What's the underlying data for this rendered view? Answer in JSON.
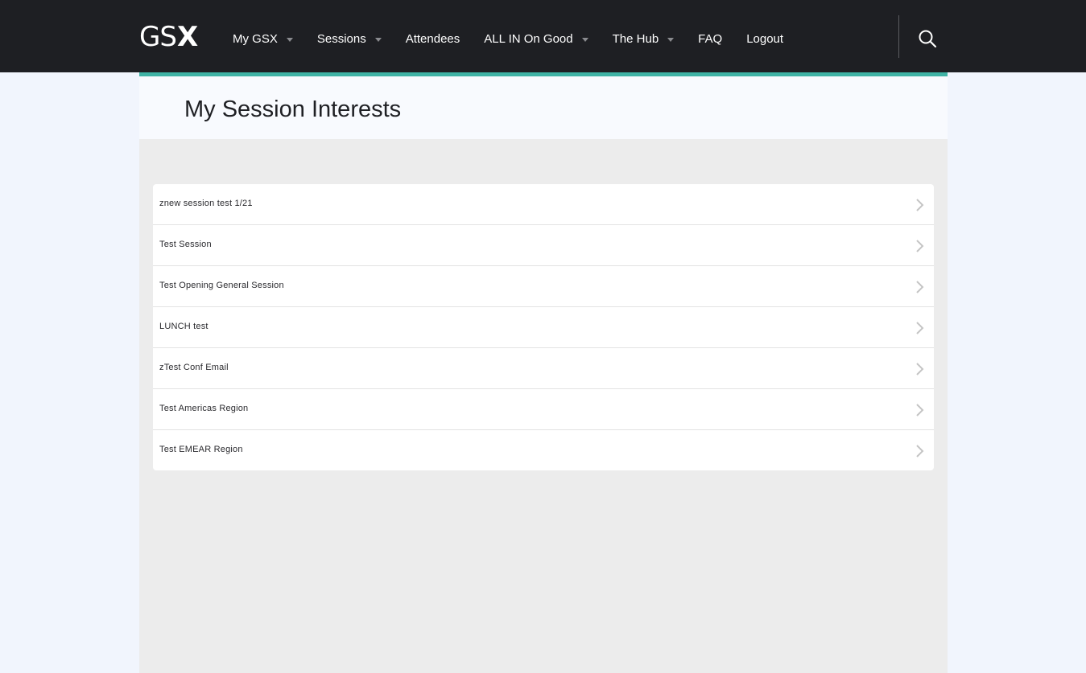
{
  "header": {
    "logo": {
      "part1": "GS",
      "part2": "X"
    },
    "nav": [
      {
        "label": "My GSX",
        "has_dropdown": true
      },
      {
        "label": "Sessions",
        "has_dropdown": true
      },
      {
        "label": "Attendees",
        "has_dropdown": false
      },
      {
        "label": "ALL IN On Good",
        "has_dropdown": true
      },
      {
        "label": "The Hub",
        "has_dropdown": true
      },
      {
        "label": "FAQ",
        "has_dropdown": false
      },
      {
        "label": "Logout",
        "has_dropdown": false
      }
    ],
    "search_icon": "search-icon"
  },
  "page": {
    "title": "My Session Interests",
    "accent_color": "#3fb3a5"
  },
  "sessions": [
    {
      "label": "znew session test 1/21"
    },
    {
      "label": "Test Session"
    },
    {
      "label": "Test Opening General Session"
    },
    {
      "label": "LUNCH test"
    },
    {
      "label": "zTest Conf Email"
    },
    {
      "label": "Test Americas Region"
    },
    {
      "label": "Test EMEAR Region"
    }
  ]
}
